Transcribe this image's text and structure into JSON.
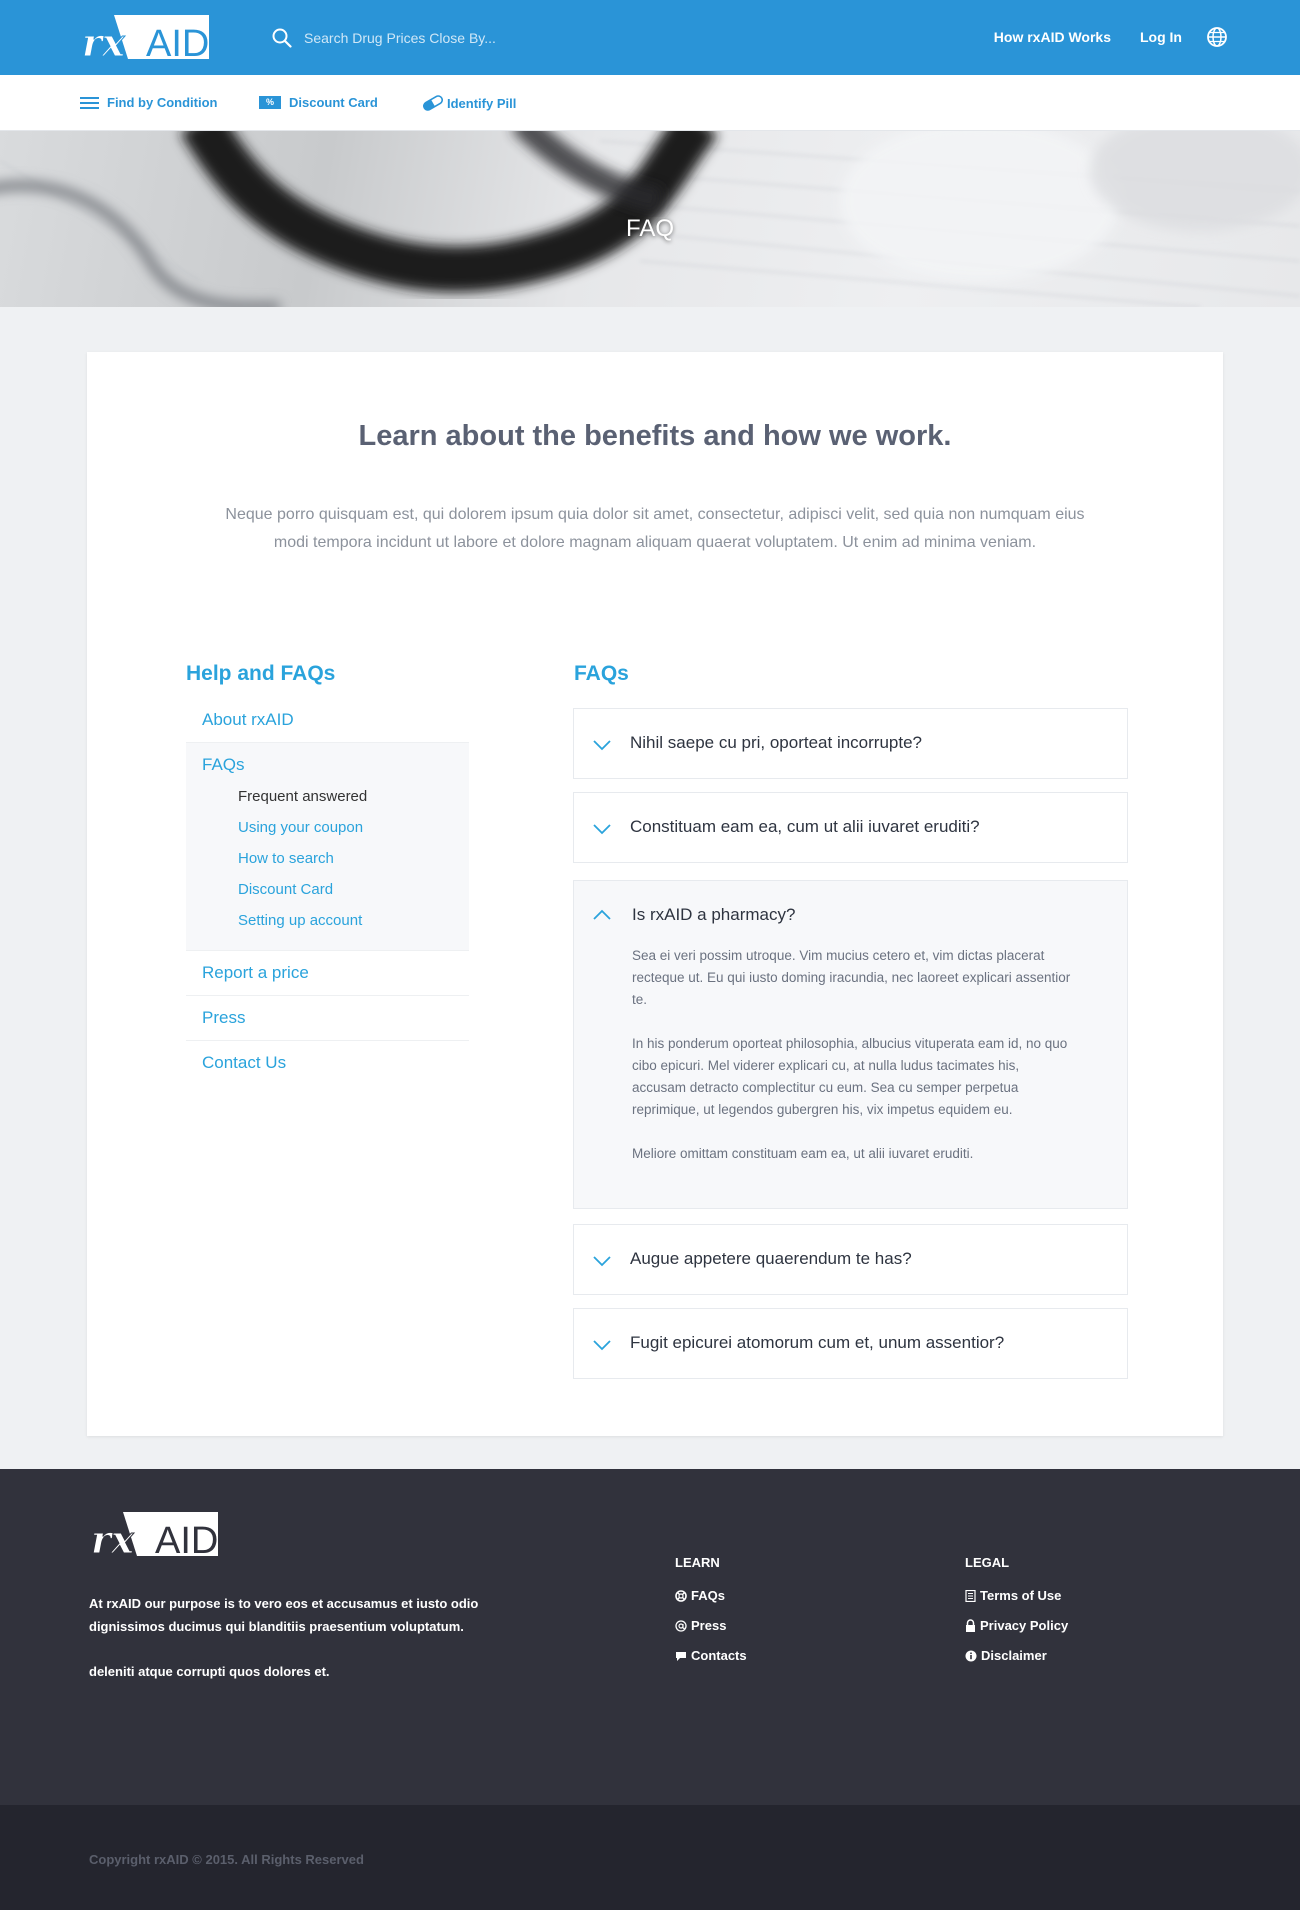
{
  "header": {
    "logo_text": "rxAID",
    "search_placeholder": "Search Drug Prices Close By...",
    "nav": [
      "How rxAID Works",
      "Log In"
    ],
    "globe_icon": "globe-icon",
    "bg_color": "#2a94d7"
  },
  "subnav": {
    "items": [
      {
        "label": "Find by Condition",
        "icon": "menu-lines-icon"
      },
      {
        "label": "Discount Card",
        "icon": "percent-badge-icon",
        "badge": "%"
      },
      {
        "label": "Identify Pill",
        "icon": "pill-icon"
      }
    ]
  },
  "hero": {
    "title": "FAQ"
  },
  "main": {
    "headline": "Learn about the benefits and how we work.",
    "intro": "Neque porro quisquam est, qui dolorem ipsum quia dolor sit amet, consectetur, adipisci velit, sed quia non numquam eius modi tempora incidunt ut labore et dolore magnam aliquam quaerat voluptatem. Ut enim ad minima veniam."
  },
  "sidebar": {
    "title": "Help and FAQs",
    "items": [
      "About rxAID",
      "FAQs",
      "Report a price",
      "Press",
      "Contact Us"
    ],
    "faq_subitems": [
      "Frequent answered",
      "Using your coupon",
      "How to search",
      "Discount Card",
      "Setting up account"
    ],
    "current_subitem": "Frequent answered"
  },
  "faqs": {
    "title": "FAQs",
    "items": [
      {
        "question": "Nihil saepe cu pri, oporteat incorrupte?",
        "open": false
      },
      {
        "question": "Constituam eam ea, cum ut alii iuvaret eruditi?",
        "open": false
      },
      {
        "question": "Is rxAID a pharmacy?",
        "open": true,
        "answer": [
          "Sea ei veri possim utroque. Vim mucius cetero et, vim dictas placerat recteque ut. Eu qui iusto doming iracundia, nec laoreet explicari assentior te.",
          "In his ponderum oporteat philosophia, albucius vituperata eam id, no quo cibo epicuri. Mel viderer explicari cu, at nulla ludus tacimates his, accusam detracto complectitur cu eum. Sea cu semper perpetua reprimique, ut legendos gubergren his, vix impetus equidem eu.",
          "Meliore omittam constituam eam ea, ut alii iuvaret eruditi."
        ]
      },
      {
        "question": "Augue appetere quaerendum te has?",
        "open": false
      },
      {
        "question": "Fugit epicurei atomorum cum et, unum assentior?",
        "open": false
      }
    ]
  },
  "footer": {
    "about": [
      "At rxAID our purpose is to vero eos et accusamus et iusto odio dignissimos ducimus qui blanditiis praesentium voluptatum.",
      "deleniti atque corrupti quos dolores et."
    ],
    "learn": {
      "title": "LEARN",
      "links": [
        {
          "label": "FAQs",
          "icon": "lifebuoy-icon"
        },
        {
          "label": "Press",
          "icon": "at-sign-icon"
        },
        {
          "label": "Contacts",
          "icon": "chat-bubble-icon"
        }
      ]
    },
    "legal": {
      "title": "LEGAL",
      "links": [
        {
          "label": "Terms of Use",
          "icon": "document-icon"
        },
        {
          "label": "Privacy Policy",
          "icon": "lock-icon"
        },
        {
          "label": "Disclaimer",
          "icon": "info-icon"
        }
      ]
    },
    "copyright": "Copyright rxAID © 2015. All Rights Reserved"
  }
}
